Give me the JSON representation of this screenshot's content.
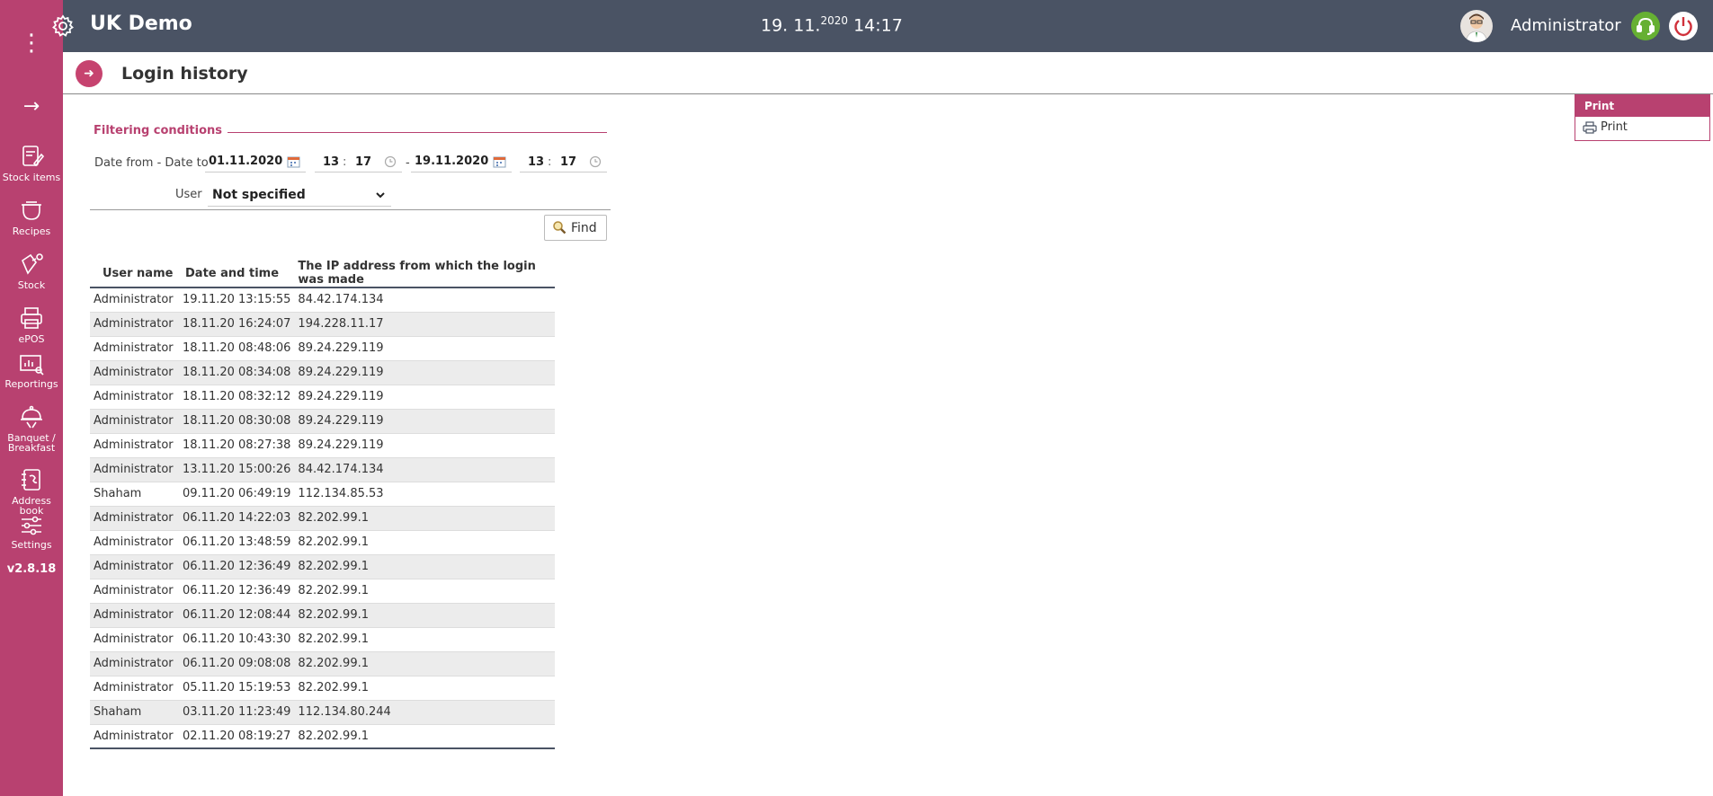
{
  "header": {
    "app_title": "UK Demo",
    "date_main": "19. 11.",
    "date_year": "2020",
    "time": "14:17",
    "user": "Administrator"
  },
  "sidebar": {
    "items": [
      {
        "label": "Stock items",
        "icon": "stock-items-icon"
      },
      {
        "label": "Recipes",
        "icon": "recipes-icon"
      },
      {
        "label": "Stock",
        "icon": "stock-icon"
      },
      {
        "label": "ePOS",
        "icon": "epos-printer-icon"
      },
      {
        "label": "Reportings",
        "icon": "reportings-icon"
      },
      {
        "label": "Banquet /",
        "label2": "Breakfast",
        "icon": "banquet-icon"
      },
      {
        "label": "Address book",
        "icon": "address-book-icon"
      },
      {
        "label": "Settings",
        "icon": "settings-sliders-icon"
      }
    ],
    "version": "v2.8.18"
  },
  "page": {
    "title": "Login history"
  },
  "print_panel": {
    "header": "Print",
    "item": "Print"
  },
  "filter": {
    "title": "Filtering conditions",
    "date_label": "Date from - Date to",
    "date_from": "01.11.2020",
    "hour_from": "13",
    "minute_from": "17",
    "dash": "-",
    "date_to": "19.11.2020",
    "hour_to": "13",
    "minute_to": "17",
    "colon": ":",
    "user_label": "User",
    "user_value": "Not specified",
    "find_label": "Find"
  },
  "table": {
    "headers": [
      "User name",
      "Date and time",
      "The IP address from which the login was made"
    ],
    "rows": [
      [
        "Administrator",
        "19.11.20 13:15:55",
        "84.42.174.134"
      ],
      [
        "Administrator",
        "18.11.20 16:24:07",
        "194.228.11.17"
      ],
      [
        "Administrator",
        "18.11.20 08:48:06",
        "89.24.229.119"
      ],
      [
        "Administrator",
        "18.11.20 08:34:08",
        "89.24.229.119"
      ],
      [
        "Administrator",
        "18.11.20 08:32:12",
        "89.24.229.119"
      ],
      [
        "Administrator",
        "18.11.20 08:30:08",
        "89.24.229.119"
      ],
      [
        "Administrator",
        "18.11.20 08:27:38",
        "89.24.229.119"
      ],
      [
        "Administrator",
        "13.11.20 15:00:26",
        "84.42.174.134"
      ],
      [
        "Shaham",
        "09.11.20 06:49:19",
        "112.134.85.53"
      ],
      [
        "Administrator",
        "06.11.20 14:22:03",
        "82.202.99.1"
      ],
      [
        "Administrator",
        "06.11.20 13:48:59",
        "82.202.99.1"
      ],
      [
        "Administrator",
        "06.11.20 12:36:49",
        "82.202.99.1"
      ],
      [
        "Administrator",
        "06.11.20 12:36:49",
        "82.202.99.1"
      ],
      [
        "Administrator",
        "06.11.20 12:08:44",
        "82.202.99.1"
      ],
      [
        "Administrator",
        "06.11.20 10:43:30",
        "82.202.99.1"
      ],
      [
        "Administrator",
        "06.11.20 09:08:08",
        "82.202.99.1"
      ],
      [
        "Administrator",
        "05.11.20 15:19:53",
        "82.202.99.1"
      ],
      [
        "Shaham",
        "03.11.20 11:23:49",
        "112.134.80.244"
      ],
      [
        "Administrator",
        "02.11.20 08:19:27",
        "82.202.99.1"
      ]
    ]
  },
  "colors": {
    "accent": "#b84170",
    "header": "#4a5364",
    "support": "#66b033"
  }
}
